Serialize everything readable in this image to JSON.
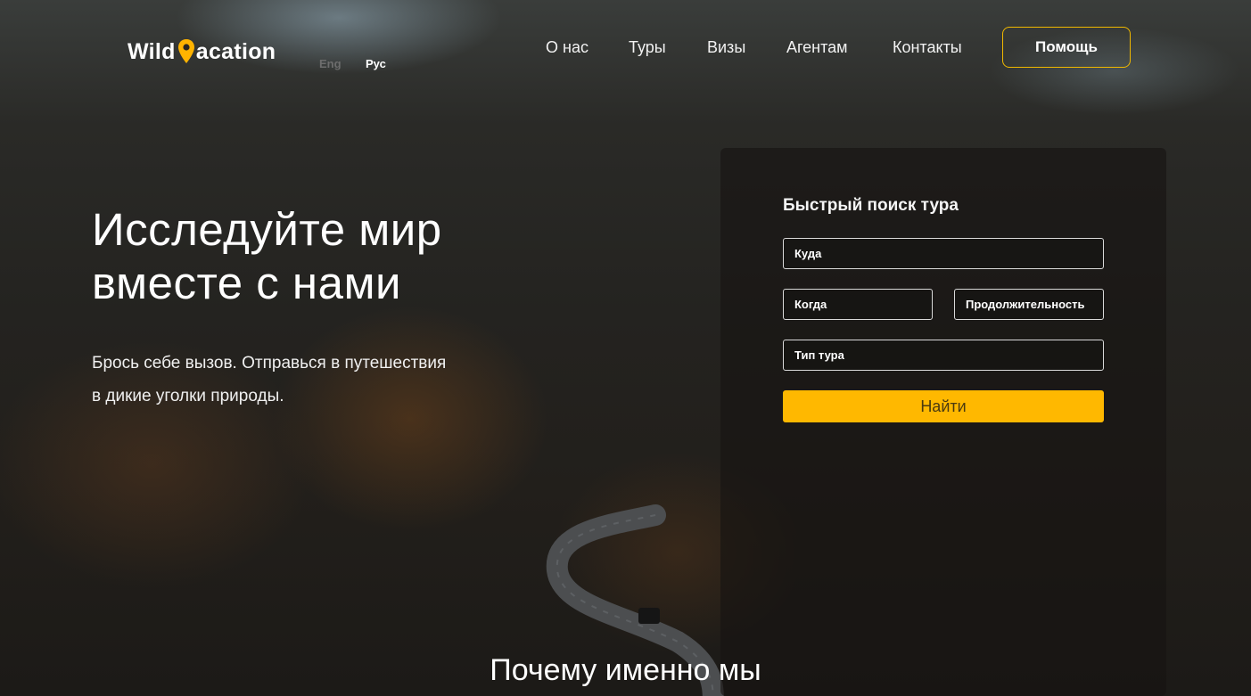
{
  "brand": {
    "logo_left": "Wild",
    "logo_right": "acation",
    "accent_color": "#ffb800"
  },
  "header": {
    "languages": [
      "Eng",
      "Рус"
    ],
    "active_language": "Рус",
    "nav": [
      "О нас",
      "Туры",
      "Визы",
      "Агентам",
      "Контакты"
    ],
    "help_label": "Помощь"
  },
  "hero": {
    "headline_line1": "Исследуйте мир",
    "headline_line2": "вместе с нами",
    "subtext_line1": "Брось себе вызов. Отправься в путешествия",
    "subtext_line2": "в дикие уголки природы."
  },
  "search": {
    "title": "Быстрый поиск тура",
    "where": "Куда",
    "when": "Когда",
    "duration": "Продолжительность",
    "tour_type": "Тип тура",
    "submit": "Найти"
  },
  "next_section": {
    "title": "Почему именно мы"
  }
}
